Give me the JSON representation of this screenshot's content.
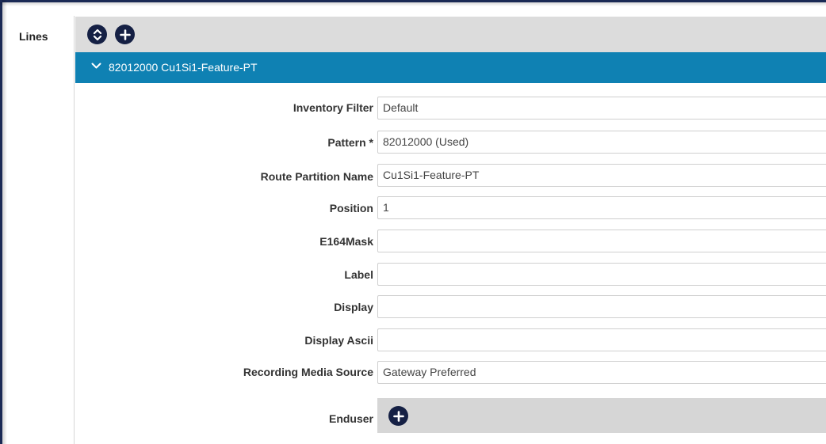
{
  "lines": {
    "label": "Lines",
    "toolbar": {
      "reorder_icon": "up-down-chevron-icon",
      "add_icon": "plus-icon"
    },
    "item": {
      "expanded_icon": "chevron-down-icon",
      "title": "82012000 Cu1Si1-Feature-PT"
    },
    "fields": [
      {
        "label": "Inventory Filter",
        "value": "Default"
      },
      {
        "label": "Pattern *",
        "value": "82012000 (Used)"
      },
      {
        "label": "Route Partition Name",
        "value": "Cu1Si1-Feature-PT"
      },
      {
        "label": "Position",
        "value": "1"
      },
      {
        "label": "E164Mask",
        "value": ""
      },
      {
        "label": "Label",
        "value": ""
      },
      {
        "label": "Display",
        "value": ""
      },
      {
        "label": "Display Ascii",
        "value": ""
      },
      {
        "label": "Recording Media Source",
        "value": "Gateway Preferred"
      }
    ],
    "enduser": {
      "label": "Enduser",
      "add_icon": "plus-icon"
    }
  },
  "colors": {
    "header_bar": "#0f81b3",
    "button": "#152044",
    "toolbar": "#dcdcdc"
  }
}
